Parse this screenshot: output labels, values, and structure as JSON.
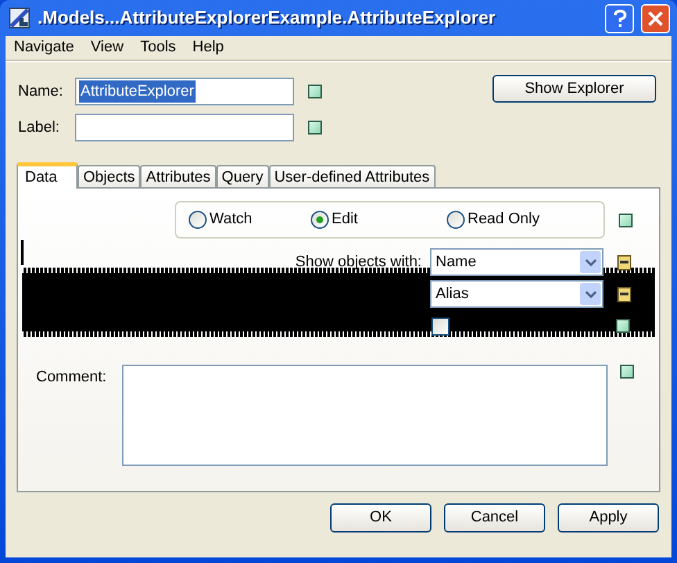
{
  "window": {
    "title": ".Models...AttributeExplorerExample.AttributeExplorer"
  },
  "menu": [
    "Navigate",
    "View",
    "Tools",
    "Help"
  ],
  "name_field": {
    "label": "Name:",
    "value": "AttributeExplorer",
    "selected": true,
    "indicator": {
      "kind": "ok"
    }
  },
  "label_field": {
    "label": "Label:",
    "indicator": {
      "kind": "ok"
    }
  },
  "show_explorer_button": "Show Explorer",
  "tabs": [
    {
      "label": "Data",
      "selected": true
    },
    {
      "label": "Objects",
      "selected": false
    },
    {
      "label": "Attributes",
      "selected": false
    },
    {
      "label": "Query",
      "selected": false
    },
    {
      "label": "User-defined Attributes",
      "selected": false
    }
  ],
  "mode": {
    "options": [
      {
        "label": "Watch",
        "selected": false
      },
      {
        "label": "Edit",
        "selected": true
      },
      {
        "label": "Read Only",
        "selected": false
      }
    ],
    "indicator": {
      "kind": "ok"
    }
  },
  "show_objects_with": {
    "label": "Show objects with:",
    "dropdowns": [
      {
        "value": "Name",
        "indicator": {
          "kind": "minus"
        }
      },
      {
        "value": "Alias",
        "indicator": {
          "kind": "minus"
        }
      }
    ]
  },
  "checkbox": {
    "checked": false,
    "indicator": {
      "kind": "ok"
    }
  },
  "comment": {
    "label": "Comment:",
    "indicator": {
      "kind": "ok"
    }
  },
  "buttons": [
    "OK",
    "Cancel",
    "Apply"
  ]
}
